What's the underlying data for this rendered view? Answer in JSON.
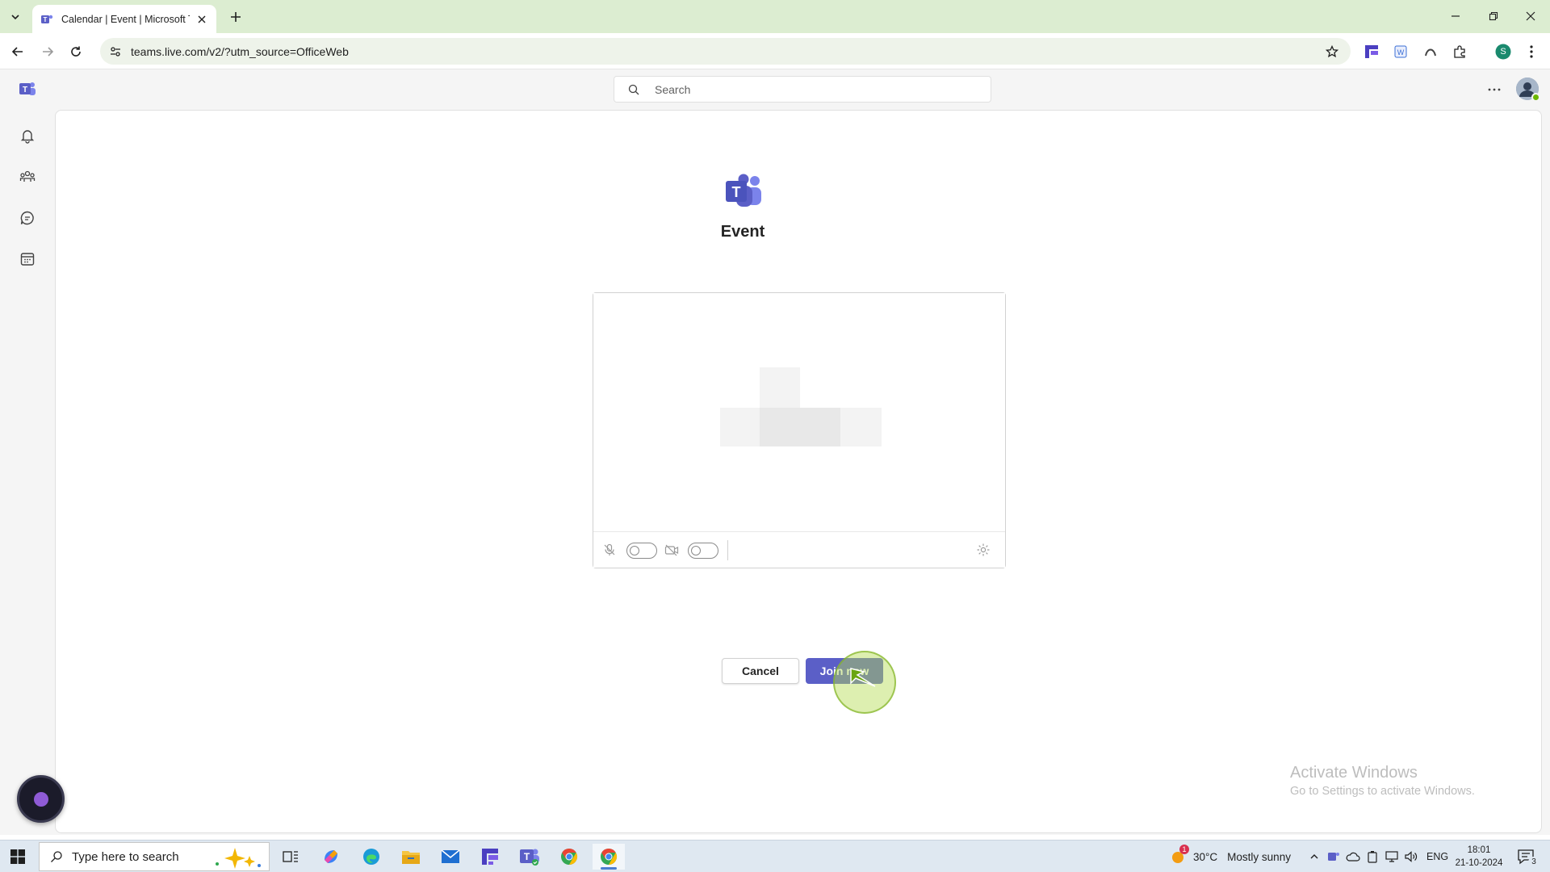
{
  "browser": {
    "tab_title": "Calendar | Event | Microsoft Teams",
    "url": "teams.live.com/v2/?utm_source=OfficeWeb",
    "profile_initial": "S"
  },
  "teams": {
    "search_placeholder": "Search",
    "brand_color": "#5b5fc7",
    "event_title": "Event",
    "cancel_label": "Cancel",
    "join_label": "Join now",
    "rail_items": [
      "bell-icon",
      "people-icon",
      "chat-icon",
      "calendar-icon"
    ]
  },
  "watermark": {
    "title": "Activate Windows",
    "subtitle": "Go to Settings to activate Windows."
  },
  "taskbar": {
    "search_placeholder": "Type here to search",
    "weather_temp": "30°C",
    "weather_text": "Mostly sunny",
    "weather_badge": "1",
    "language": "ENG",
    "time": "18:01",
    "date": "21-10-2024",
    "notification_count": "3"
  }
}
